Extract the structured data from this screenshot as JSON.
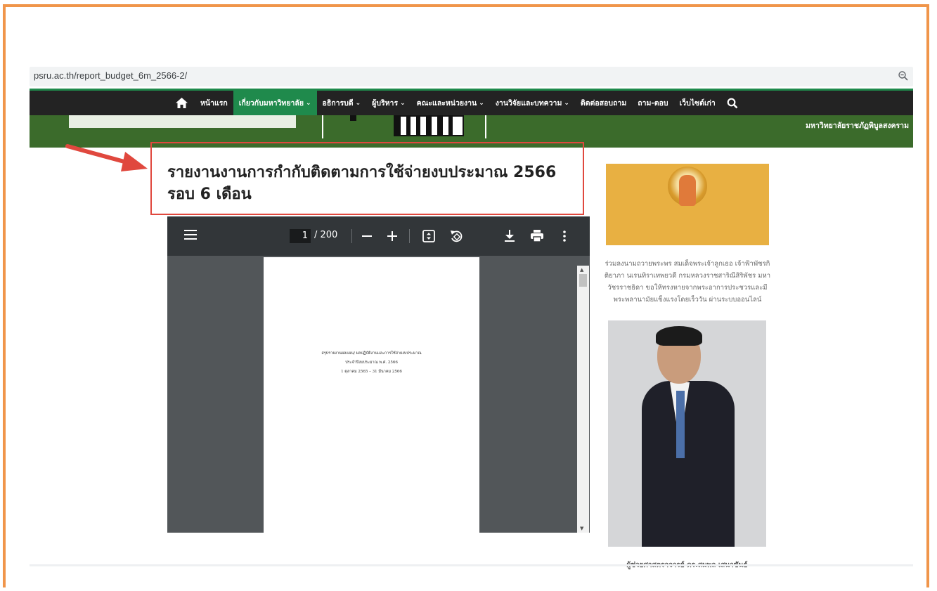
{
  "browser": {
    "url": "psru.ac.th/report_budget_6m_2566-2/",
    "zoom_icon": "zoom-out-icon"
  },
  "nav": {
    "home_icon": "home-icon",
    "items": [
      {
        "label": "หน้าแรก",
        "caret": ""
      },
      {
        "label": "เกี่ยวกับมหาวิทยาลัย",
        "caret": "⌄"
      },
      {
        "label": "อธิการบดี",
        "caret": "⌄"
      },
      {
        "label": "ผู้บริหาร",
        "caret": "⌄"
      },
      {
        "label": "คณะและหน่วยงาน",
        "caret": "⌄"
      },
      {
        "label": "งานวิจัยและบทความ",
        "caret": "⌄"
      },
      {
        "label": "ติดต่อสอบถาม",
        "caret": ""
      },
      {
        "label": "ถาม-ตอบ",
        "caret": ""
      },
      {
        "label": "เว็บไซต์เก่า",
        "caret": ""
      }
    ],
    "search_icon": "search-icon",
    "active_color": "#1f8a4c"
  },
  "banner": {
    "university_name": "มหาวิทยาลัยราชภัฏพิบูลสงคราม"
  },
  "page": {
    "title": "รายงานงานการกำกับติดตามการใช้จ่ายงบประมาณ 2566 รอบ 6 เดือน",
    "highlight_color": "#e0483e"
  },
  "pdf_viewer": {
    "current_page": "1",
    "total_pages": "/ 200",
    "page_lines": [
      "สรุปรายงานผลแผน/ ผลปฏิบัติงานและการใช้จ่ายงบประมาณ",
      "ประจำปีงบประมาณ พ.ศ. 2566",
      "1 ตุลาคม 2565 – 31 มีนาคม 2566"
    ],
    "toolbar_icons": [
      "menu-icon",
      "zoom-out-icon",
      "zoom-in-icon",
      "fit-page-icon",
      "rotate-icon",
      "download-icon",
      "print-icon",
      "more-icon"
    ]
  },
  "sidebar": {
    "royal_text": "ร่วมลงนามถวายพระพร สมเด็จพระเจ้าลูกเธอ เจ้าฟ้าพัชรกิติยาภา นเรนทิราเทพยวดี กรมหลวงราชสาริณีสิริพัชร มหาวัชรราชธิดา ขอให้ทรงหายจากพระอาการประชวรและมีพระพลานามัยแข็งแรงโดยเร็ววัน ผ่านระบบออนไลน์",
    "president_caption": "ผู้ช่วยศาสตราจารย์ ดร.สมพล เสนาขันธ์"
  }
}
